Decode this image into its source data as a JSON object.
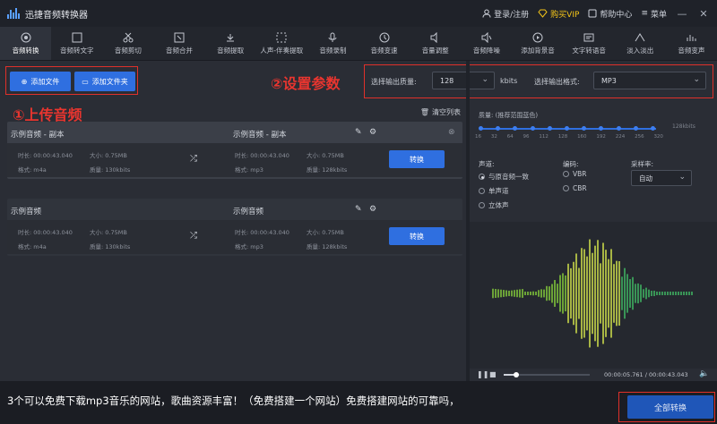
{
  "app": {
    "title": "迅捷音频转换器"
  },
  "titlebar": {
    "login": "登录/注册",
    "vip": "购买VIP",
    "help": "帮助中心",
    "menu": "菜单"
  },
  "tools": [
    {
      "label": "音频转换",
      "icon": "convert-icon"
    },
    {
      "label": "音频转文字",
      "icon": "speech-to-text-icon"
    },
    {
      "label": "音频剪切",
      "icon": "scissors-icon"
    },
    {
      "label": "音频合并",
      "icon": "merge-icon"
    },
    {
      "label": "音频提取",
      "icon": "extract-icon"
    },
    {
      "label": "人声-伴奏提取",
      "icon": "vocal-split-icon"
    },
    {
      "label": "音频录制",
      "icon": "microphone-icon"
    },
    {
      "label": "音频变速",
      "icon": "speed-icon"
    },
    {
      "label": "音量调整",
      "icon": "volume-icon"
    },
    {
      "label": "音频降噪",
      "icon": "denoise-icon"
    },
    {
      "label": "添加背景音",
      "icon": "background-music-icon"
    },
    {
      "label": "文字转语音",
      "icon": "text-to-speech-icon"
    },
    {
      "label": "淡入淡出",
      "icon": "fade-icon"
    },
    {
      "label": "音频变声",
      "icon": "voice-change-icon"
    }
  ],
  "add": {
    "add_file": "添加文件",
    "add_folder": "添加文件夹"
  },
  "annotations": {
    "step1": "①上传音频",
    "step2": "②设置参数"
  },
  "params": {
    "quality_label": "选择输出质量:",
    "quality_value": "128",
    "quality_unit": "kbits",
    "format_label": "选择输出格式:",
    "format_value": "MP3"
  },
  "list": {
    "clear": "清空列表"
  },
  "cards": [
    {
      "src_name": "示例音频 - 副本",
      "dst_name": "示例音频 - 副本",
      "src_duration": "时长: 00:00:43.040",
      "src_size": "大小: 0.75MB",
      "src_format": "格式: m4a",
      "src_quality": "质量: 130kbits",
      "dst_duration": "时长: 00:00:43.040",
      "dst_size": "大小: 0.75MB",
      "dst_format": "格式: mp3",
      "dst_quality": "质量: 128kbits",
      "action": "转换"
    },
    {
      "src_name": "示例音频",
      "dst_name": "示例音频",
      "src_duration": "时长: 00:00:43.040",
      "src_size": "大小: 0.75MB",
      "src_format": "格式: m4a",
      "src_quality": "质量: 130kbits",
      "dst_duration": "时长: 00:00:43.040",
      "dst_size": "大小: 0.75MB",
      "dst_format": "格式: mp3",
      "dst_quality": "质量: 128kbits",
      "action": "转换"
    }
  ],
  "settings": {
    "quality_title": "质量: (推荐范围蓝色)",
    "scale_max": "128kbits",
    "ticks": [
      "16",
      "32",
      "64",
      "96",
      "112",
      "128",
      "160",
      "192",
      "224",
      "256",
      "320"
    ],
    "channel_title": "声道:",
    "channels": [
      "与原音频一致",
      "单声道",
      "立体声"
    ],
    "encoding_title": "编码:",
    "encodings": [
      "VBR",
      "CBR"
    ],
    "samplerate_title": "采样率:",
    "samplerate_value": "自动"
  },
  "player": {
    "time": "00:00:05.761 / 00:00:43.043"
  },
  "caption": "3个可以免费下载mp3音乐的网站，歌曲资源丰富！（免费搭建一个网站）免费搭建网站的可靠吗，",
  "convert_all": "全部转换"
}
